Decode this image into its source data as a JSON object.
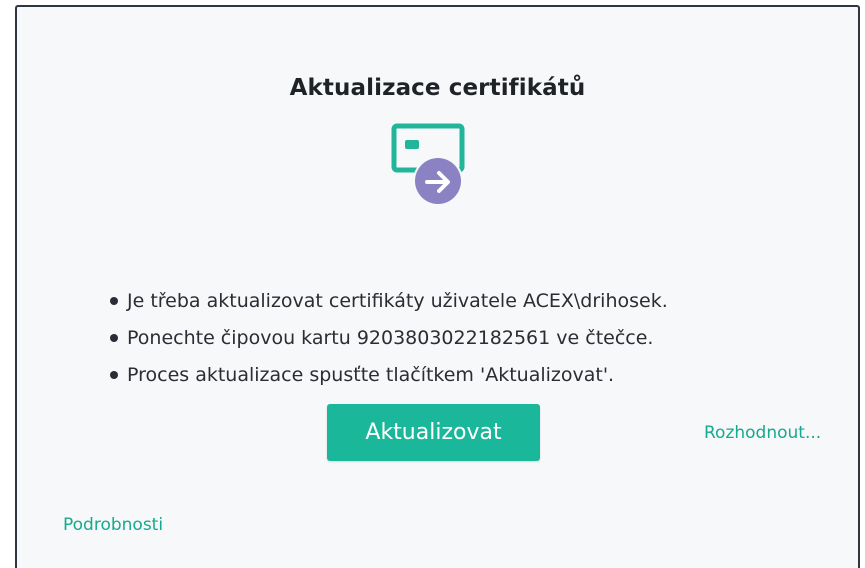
{
  "dialog": {
    "title": "Aktualizace certifikátů",
    "icon": "smartcard-arrow-icon",
    "bullets": [
      "Je třeba aktualizovat certifikáty uživatele ACEX\\drihosek.",
      "Ponechte čipovou kartu 9203803022182561 ve čtečce.",
      "Proces aktualizace spusťte tlačítkem 'Aktualizovat'."
    ],
    "update_button": "Aktualizovat",
    "decide_link": "Rozhodnout...",
    "details_link": "Podrobnosti"
  },
  "colors": {
    "accent": "#1ab79b",
    "card": "#22b59a",
    "arrow_circle": "#8b82c4",
    "border": "#303542"
  }
}
